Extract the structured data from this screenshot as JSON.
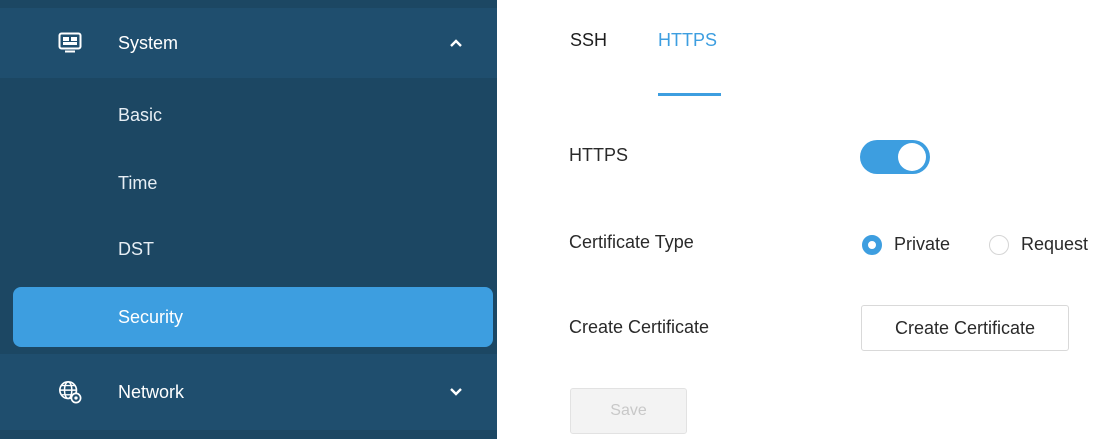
{
  "sidebar": {
    "system": {
      "label": "System",
      "icon": "monitor-icon",
      "expanded": true
    },
    "items": [
      {
        "label": "Basic"
      },
      {
        "label": "Time"
      },
      {
        "label": "DST"
      },
      {
        "label": "Security",
        "active": true
      }
    ],
    "network": {
      "label": "Network",
      "icon": "globe-gear-icon",
      "expanded": false
    }
  },
  "tabs": [
    {
      "label": "SSH",
      "active": false
    },
    {
      "label": "HTTPS",
      "active": true
    }
  ],
  "form": {
    "https": {
      "label": "HTTPS",
      "enabled": true
    },
    "certificate_type": {
      "label": "Certificate Type",
      "options": [
        {
          "label": "Private",
          "selected": true
        },
        {
          "label": "Request",
          "selected": false
        }
      ]
    },
    "create_certificate": {
      "label": "Create Certificate",
      "button_label": "Create Certificate"
    },
    "save_label": "Save"
  },
  "colors": {
    "sidebar_bg": "#1c4763",
    "sidebar_group_bg": "#1f4e6e",
    "accent": "#3d9ee0"
  }
}
